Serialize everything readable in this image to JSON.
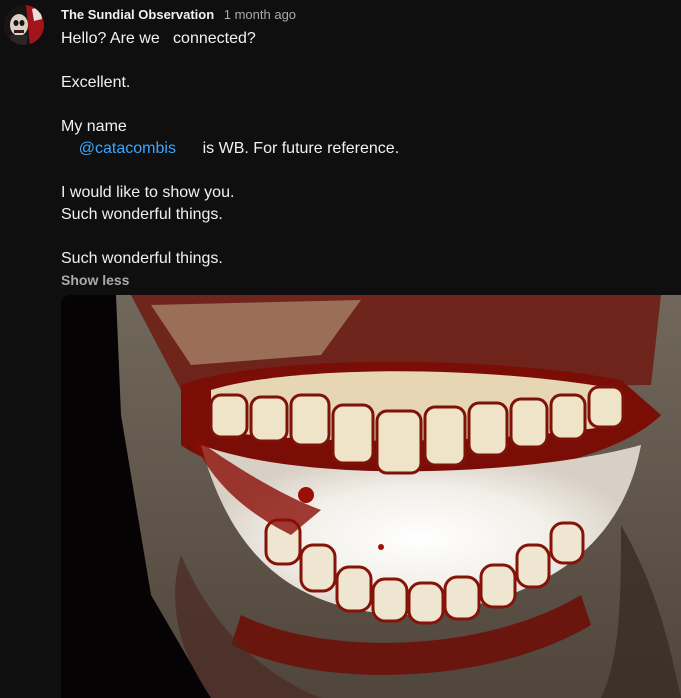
{
  "post": {
    "channel_name": "The Sundial Observation",
    "time_ago": "1 month ago",
    "avatar_icon": "avatar-icon",
    "body_lines": [
      {
        "pre": "Hello? Are we   connected?"
      },
      {
        "pre": ""
      },
      {
        "pre": "Excellent."
      },
      {
        "pre": ""
      },
      {
        "pre": "My name"
      },
      {
        "pre": "    ",
        "mention": "@catacombis",
        "post": "      is WB. For future reference."
      },
      {
        "pre": ""
      },
      {
        "pre": "I would like to show you."
      },
      {
        "pre": "Such wonderful things."
      },
      {
        "pre": ""
      },
      {
        "pre": "Such wonderful things."
      }
    ],
    "show_less_label": "Show less",
    "image_icon": "grinning-mouth-image"
  },
  "colors": {
    "background": "#0f0f0f",
    "text": "#f1f1f1",
    "secondary_text": "#aaaaaa",
    "link": "#3ea6ff",
    "blood": "#8a0e06"
  }
}
